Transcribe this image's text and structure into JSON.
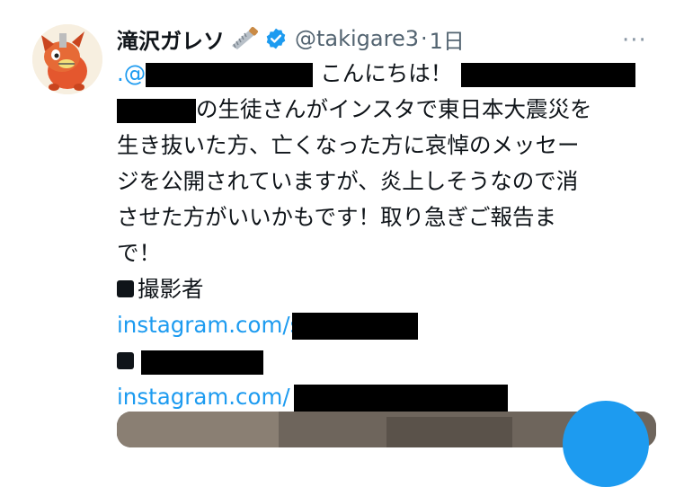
{
  "tweet": {
    "author_name": "滝沢ガレソ",
    "handle": "@takigare3",
    "separator": "·",
    "time": "1日",
    "more_label": "···",
    "mention_prefix": ".@",
    "greeting": "こんにちは！",
    "body_line2": "の生徒さんがインスタで東日本大震災を",
    "body_line3": "生き抜いた方、亡くなった方に哀悼のメッセー",
    "body_line4": "ジを公開されていますが、炎上しそうなので消",
    "body_line5": "させた方がいいかもです！取り急ぎご報告ま",
    "body_line6": "で！",
    "photographer_label": "撮影者",
    "link1": "instagram.com/s",
    "link2": "instagram.com/"
  },
  "icons": {
    "verified": "verified-badge-icon",
    "saw": "saw-emoji-icon",
    "bullet": "black-square-icon"
  },
  "colors": {
    "link": "#1d9bf0",
    "verified": "#1d9bf0",
    "text": "#0f1419",
    "secondary": "#536471"
  }
}
